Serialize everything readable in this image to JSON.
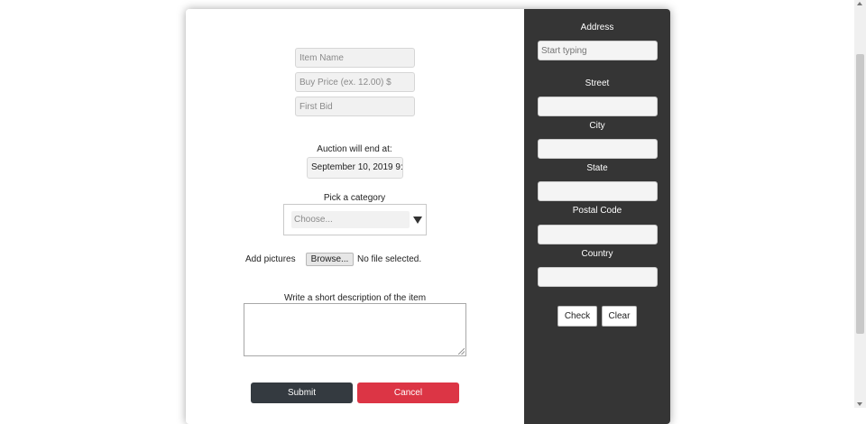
{
  "form": {
    "item_name_placeholder": "Item Name",
    "buy_price_placeholder": "Buy Price (ex. 12.00) $",
    "first_bid_placeholder": "First Bid",
    "auction_end_label": "Auction will end at:",
    "auction_end_value": "September 10, 2019 9:",
    "category_label": "Pick a category",
    "category_selected": "Choose...",
    "pictures_label": "Add pictures",
    "browse_label": "Browse...",
    "file_status": "No file selected.",
    "description_label": "Write a short description of the item",
    "submit_label": "Submit",
    "cancel_label": "Cancel"
  },
  "address": {
    "title": "Address",
    "search_placeholder": "Start typing",
    "street_label": "Street",
    "city_label": "City",
    "state_label": "State",
    "postal_label": "Postal Code",
    "country_label": "Country",
    "check_label": "Check",
    "clear_label": "Clear"
  },
  "colors": {
    "panel_dark": "#353535",
    "submit_bg": "#343a40",
    "cancel_bg": "#dc3545"
  }
}
